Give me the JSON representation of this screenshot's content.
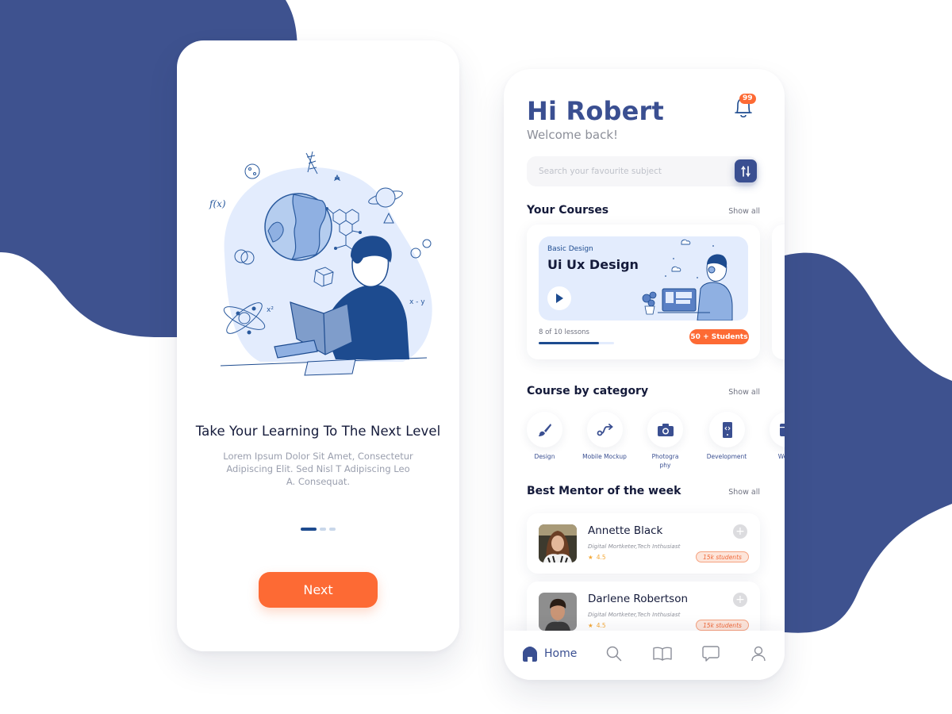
{
  "colors": {
    "brand_blue": "#3a4f91",
    "deep_blue": "#1d4b8f",
    "accent_orange": "#fd6a34",
    "light_blue": "#e3ecfd",
    "text_dark": "#141a3a",
    "text_muted": "#8c8f99"
  },
  "onboarding": {
    "title": "Take Your Learning To The Next Level",
    "body": "Lorem Ipsum Dolor Sit Amet, Consectetur Adipiscing Elit. Sed Nisl T Adipiscing Leo A. Consequat.",
    "pagination": {
      "total": 3,
      "active_index": 0
    },
    "next_label": "Next",
    "illustration": "student-reading-book-illustration",
    "illustration_labels": {
      "fx": "f(x)",
      "x2": "x²",
      "xy": "x - y"
    }
  },
  "home": {
    "greeting": "Hi Robert",
    "welcome": "Welcome back!",
    "notifications": {
      "icon": "bell-icon",
      "count": "99"
    },
    "search": {
      "placeholder": "Search your favourite subject",
      "value": "",
      "filter_icon": "sliders-icon"
    },
    "your_courses": {
      "title": "Your Courses",
      "show_all": "Show all",
      "courses": [
        {
          "category": "Basic Design",
          "name": "Ui Ux Design",
          "lessons_text": "8 of 10 lessons",
          "lessons_done": 8,
          "lessons_total": 10,
          "progress": 0.8,
          "students": "50 + Students"
        }
      ]
    },
    "categories": {
      "title": "Course by category",
      "show_all": "Show all",
      "items": [
        {
          "label": "Design",
          "icon": "brush-icon"
        },
        {
          "label": "Mobile Mockup",
          "icon": "route-icon"
        },
        {
          "label": "Photography",
          "label_display": "Photogra phy",
          "icon": "camera-icon"
        },
        {
          "label": "Development",
          "icon": "mobile-code-icon"
        },
        {
          "label": "Web d",
          "icon": "browser-icon"
        }
      ]
    },
    "mentors": {
      "title": "Best Mentor of the week",
      "show_all": "Show all",
      "items": [
        {
          "name": "Annette Black",
          "role": "Digital Mortketer,Tech Inthusiast",
          "rating": "4.5",
          "students": "15k students"
        },
        {
          "name": "Darlene Robertson",
          "role": "Digital Mortketer,Tech Inthusiast",
          "rating": "4.5",
          "students": "15k students"
        }
      ]
    },
    "tabbar": {
      "active": "home",
      "items": [
        {
          "id": "home",
          "label": "Home",
          "icon": "home-icon"
        },
        {
          "id": "search",
          "label": "",
          "icon": "search-icon"
        },
        {
          "id": "library",
          "label": "",
          "icon": "book-icon"
        },
        {
          "id": "messages",
          "label": "",
          "icon": "chat-icon"
        },
        {
          "id": "profile",
          "label": "",
          "icon": "user-icon"
        }
      ]
    }
  }
}
